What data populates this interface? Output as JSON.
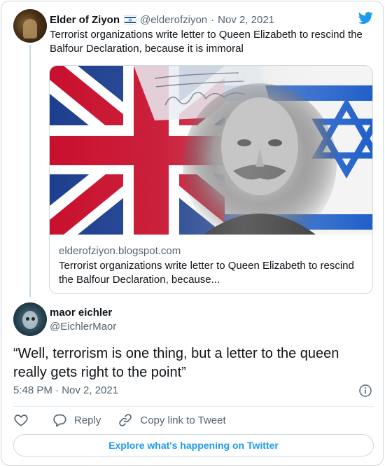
{
  "quoted_tweet": {
    "author_name": "Elder of Ziyon",
    "author_flag": "israel-flag-icon",
    "author_handle": "@elderofziyon",
    "separator": "·",
    "date": "Nov 2, 2021",
    "text": "Terrorist organizations write letter to Queen Elizabeth to rescind the Balfour Declaration, because it is immoral",
    "link_card": {
      "domain": "elderofziyon.blogspot.com",
      "title": "Terrorist organizations write letter to Queen Elizabeth to rescind the Balfour Declaration, because..."
    }
  },
  "tweet": {
    "author_name": "maor eichler",
    "author_handle": "@EichlerMaor",
    "text": "“Well, terrorism is one thing, but a letter to the queen really gets right to the point”",
    "timestamp": "5:48 PM · Nov 2, 2021"
  },
  "actions": {
    "reply_label": "Reply",
    "copy_link_label": "Copy link to Tweet"
  },
  "explore_label": "Explore what's happening on Twitter",
  "colors": {
    "accent": "#1d9bf0",
    "text_primary": "#0f1419",
    "text_secondary": "#536471",
    "border": "#cfd9de"
  },
  "icons": [
    "twitter-bird-icon",
    "israel-flag-icon",
    "info-icon",
    "heart-icon",
    "reply-bubble-icon",
    "link-icon"
  ]
}
